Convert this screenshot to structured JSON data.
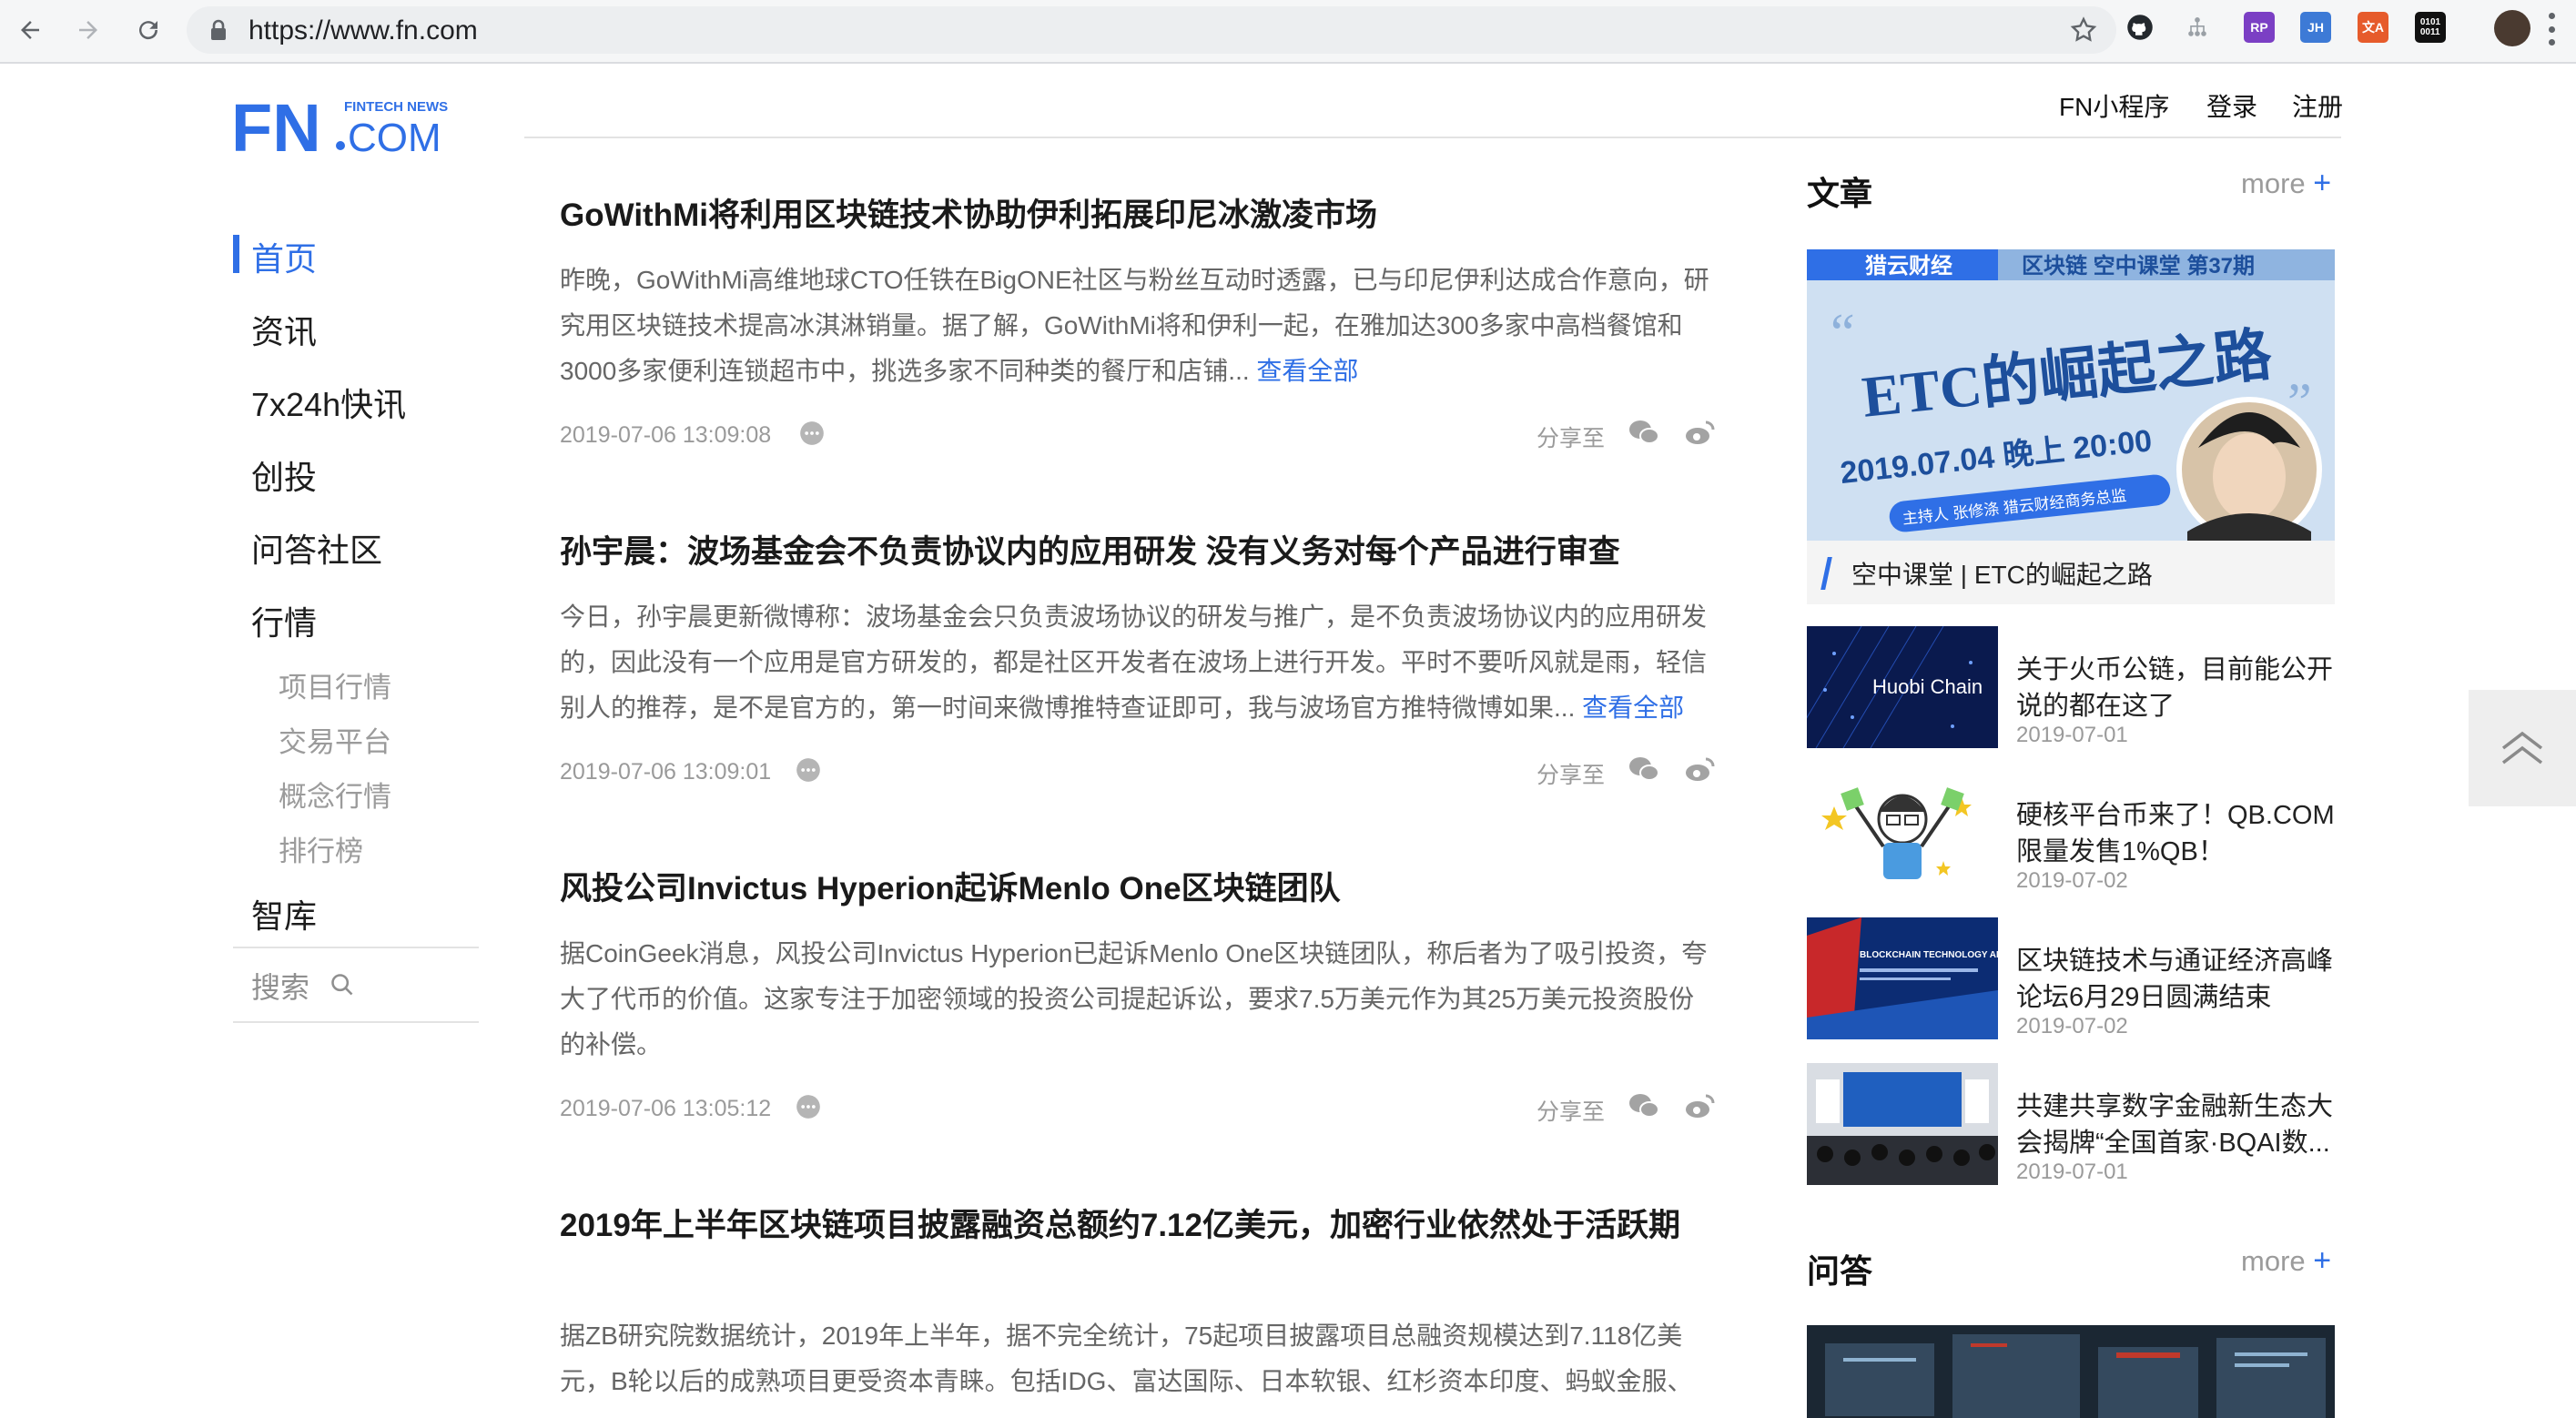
{
  "browser": {
    "url": "https://www.fn.com",
    "extensions": [
      "github-icon",
      "tree-icon",
      "rp-extension",
      "jh-extension",
      "translate-extension",
      "binary-extension"
    ],
    "ext_labels": {
      "rp": "RP",
      "jh": "JH",
      "translate": "文A",
      "binary": "0101\n0011"
    }
  },
  "logo": {
    "main": "FN",
    "dot_com": ".COM",
    "tagline": "FINTECH NEWS",
    "color": "#2f6fe6"
  },
  "header": {
    "links": [
      "FN小程序",
      "登录",
      "注册"
    ]
  },
  "nav": {
    "items": [
      "首页",
      "资讯",
      "7x24h快讯",
      "创投",
      "问答社区",
      "行情"
    ],
    "sub_items": [
      "项目行情",
      "交易平台",
      "概念行情",
      "排行榜"
    ],
    "library": "智库",
    "search": "搜索"
  },
  "articles": [
    {
      "title": "GoWithMi将利用区块链技术协助伊利拓展印尼冰激凌市场",
      "body": "昨晚，GoWithMi高维地球CTO任铁在BigONE社区与粉丝互动时透露，已与印尼伊利达成合作意向，研究用区块链技术提高冰淇淋销量。据了解，GoWithMi将和伊利一起，在雅加达300多家中高档餐馆和3000多家便利连锁超市中，挑选多家不同种类的餐厅和店铺...",
      "readmore": "查看全部",
      "date": "2019-07-06 13:09:08",
      "share": "分享至"
    },
    {
      "title": "孙宇晨：波场基金会不负责协议内的应用研发 没有义务对每个产品进行审查",
      "body": "今日，孙宇晨更新微博称：波场基金会只负责波场协议的研发与推广，是不负责波场协议内的应用研发的，因此没有一个应用是官方研发的，都是社区开发者在波场上进行开发。平时不要听风就是雨，轻信别人的推荐，是不是官方的，第一时间来微博推特查证即可，我与波场官方推特微博如果...",
      "readmore": "查看全部",
      "date": "2019-07-06 13:09:01",
      "share": "分享至"
    },
    {
      "title": "风投公司Invictus Hyperion起诉Menlo One区块链团队",
      "body": "据CoinGeek消息，风投公司Invictus Hyperion已起诉Menlo One区块链团队，称后者为了吸引投资，夸大了代币的价值。这家专注于加密领域的投资公司提起诉讼，要求7.5万美元作为其25万美元投资股份的补偿。",
      "readmore": "",
      "date": "2019-07-06 13:05:12",
      "share": "分享至"
    },
    {
      "title": "2019年上半年区块链项目披露融资总额约7.12亿美元，加密行业依然处于活跃期",
      "body": "据ZB研究院数据统计，2019年上半年，据不完全统计，75起项目披露项目总融资规模达到7.118亿美元，B轮以后的成熟项目更受资本青睐。包括IDG、富达国际、日本软银、红杉资本印度、蚂蚁金服、",
      "readmore": "",
      "date": "",
      "share": ""
    }
  ],
  "sidebar": {
    "articles_title": "文章",
    "more": "more",
    "plus": "+",
    "feature": {
      "brand": "猎云财经",
      "series": "区块链 空中课堂 第37期",
      "headline": "ETC的崛起之路",
      "datetime": "2019.07.04 晚上 20:00",
      "host": "主持人 张修涤 猎云财经商务总监",
      "caption": "空中课堂 | ETC的崛起之路"
    },
    "items": [
      {
        "title": "关于火币公链，目前能公开说的都在这了",
        "date": "2019-07-01",
        "thumb_text": "Huobi Chain"
      },
      {
        "title": "硬核平台币来了！QB.COM限量发售1%QB！",
        "date": "2019-07-02",
        "thumb_text": ""
      },
      {
        "title": "区块链技术与通证经济高峰论坛6月29日圆满结束",
        "date": "2019-07-02",
        "thumb_text": "BLOCKCHAIN TECHNOLOGY AND TOKEN ECONOMY"
      },
      {
        "title": "共建共享数字金融新生态大会揭牌“全国首家·BQAI数...",
        "date": "2019-07-01",
        "thumb_text": ""
      }
    ],
    "qa_title": "问答"
  }
}
